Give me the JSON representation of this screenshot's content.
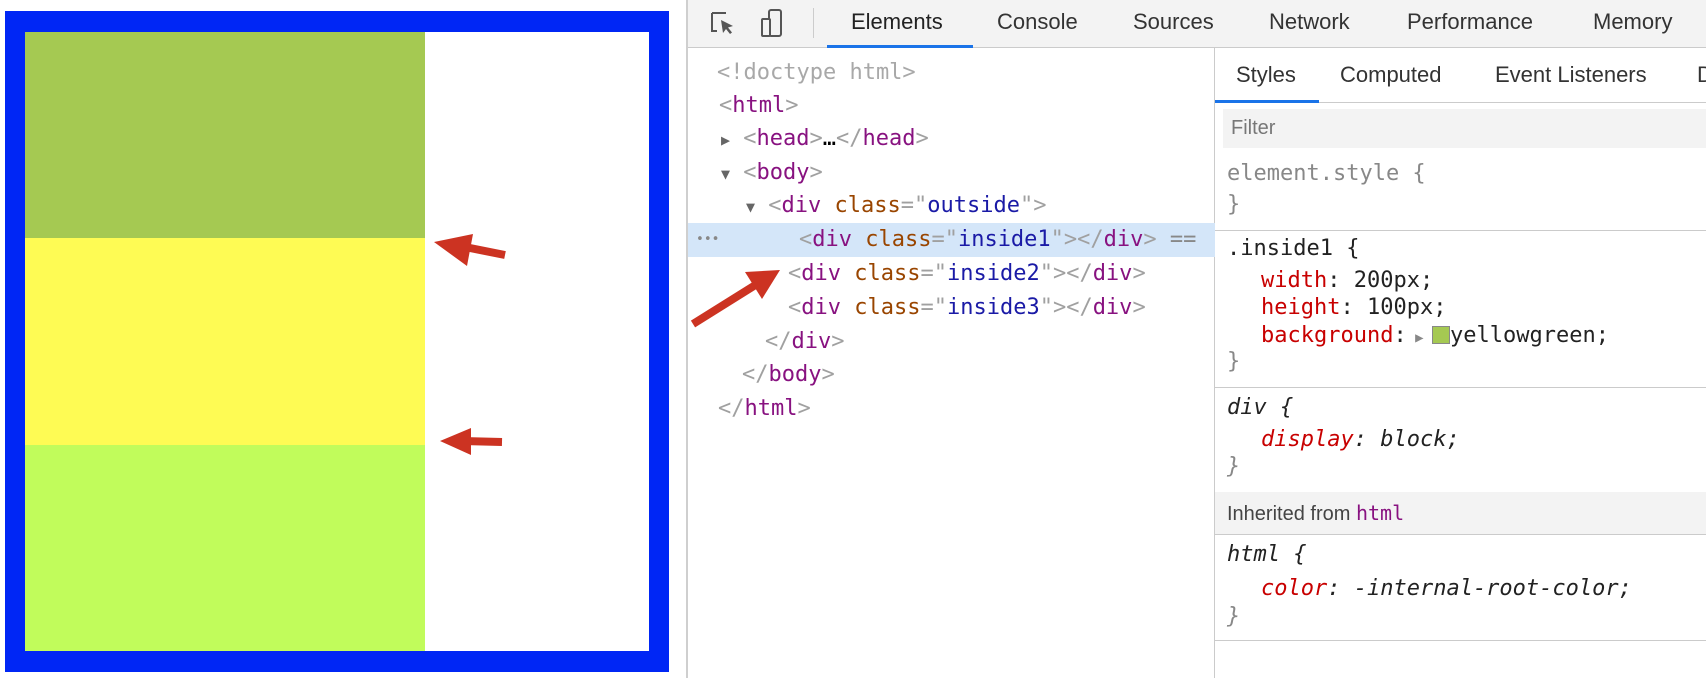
{
  "preview": {
    "colors": {
      "outside_border": "#0026f5",
      "inside1": "#a5c952",
      "inside2": "#fefb54",
      "inside3": "#c1fc5b",
      "arrow": "#cc3322"
    }
  },
  "toolbar": {
    "icons": [
      "inspect-element-icon",
      "device-toggle-icon"
    ],
    "tabs": [
      "Elements",
      "Console",
      "Sources",
      "Network",
      "Performance",
      "Memory"
    ],
    "active_tab": "Elements"
  },
  "tree": {
    "doctype": "<!doctype html>",
    "html_open": "html",
    "head": "head",
    "ellipsis": "…",
    "body": "body",
    "outside_tag": "div",
    "class_attr": "class",
    "outside_class": "outside",
    "children": [
      "inside1",
      "inside2",
      "inside3"
    ],
    "selected_suffix": "==",
    "row_dots": "•••"
  },
  "styles": {
    "tabs": [
      "Styles",
      "Computed",
      "Event Listeners",
      "D"
    ],
    "filter_placeholder": "Filter",
    "element_style": "element.style {",
    "close": "}",
    "rule1": {
      "selector": ".inside1 {",
      "props": [
        {
          "name": "width",
          "value": "200px;"
        },
        {
          "name": "height",
          "value": "100px;"
        },
        {
          "name": "background",
          "value": "yellowgreen;"
        }
      ]
    },
    "rule2": {
      "selector": "div {",
      "props": [
        {
          "name": "display",
          "value": "block;"
        }
      ]
    },
    "inherited_label": "Inherited from",
    "inherited_tag": "html",
    "rule3": {
      "selector": "html {",
      "props": [
        {
          "name": "color",
          "value": "-internal-root-color;"
        }
      ]
    }
  }
}
